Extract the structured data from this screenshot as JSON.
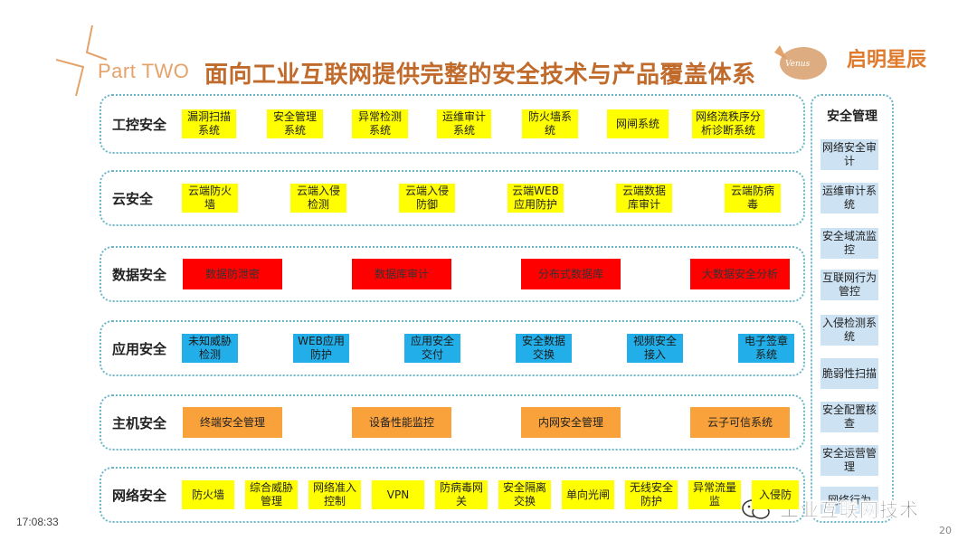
{
  "header": {
    "part_label": "Part TWO",
    "title": "面向工业互联网提供完整的安全技术与产品覆盖体系",
    "logo_text": "启明星辰",
    "logo_badge": "Venus"
  },
  "rows": [
    {
      "label": "工控安全",
      "items": [
        "漏洞扫描系统",
        "安全管理系统",
        "异常检测系统",
        "运维审计系统",
        "防火墙系统",
        "网闸系统",
        "网络流秩序分析诊断系统"
      ]
    },
    {
      "label": "云安全",
      "items": [
        "云端防火墙",
        "云端入侵检测",
        "云端入侵防御",
        "云端WEB应用防护",
        "云端数据库审计",
        "云端防病毒"
      ]
    },
    {
      "label": "数据安全",
      "items": [
        "数据防泄密",
        "数据库审计",
        "分布式数据库",
        "大数据安全分析"
      ]
    },
    {
      "label": "应用安全",
      "items": [
        "未知威胁检测",
        "WEB应用防护",
        "应用安全交付",
        "安全数据交换",
        "视频安全接入",
        "电子签章系统"
      ]
    },
    {
      "label": "主机安全",
      "items": [
        "终端安全管理",
        "设备性能监控",
        "内网安全管理",
        "云子可信系统"
      ]
    },
    {
      "label": "网络安全",
      "items": [
        "防火墙",
        "综合威胁管理",
        "网络准入控制",
        "VPN",
        "防病毒网关",
        "安全隔离交换",
        "单向光闸",
        "无线安全防护",
        "异常流量监",
        "入侵防"
      ]
    }
  ],
  "side": {
    "title": "安全管理",
    "items": [
      "网络安全审计",
      "运维审计系统",
      "安全域流监控",
      "互联网行为管控",
      "入侵检测系统",
      "脆弱性扫描",
      "安全配置核查",
      "安全运营管理",
      "网络行为"
    ]
  },
  "footer": {
    "time": "17:08:33",
    "page": "20",
    "watermark": "工业互联网技术"
  },
  "colors": {
    "yellow": "#ffff00",
    "red": "#ff0000",
    "blue": "#22aee8",
    "orange": "#f9a13a",
    "title": "#c06a2b",
    "frame": "#6ab6c8"
  }
}
